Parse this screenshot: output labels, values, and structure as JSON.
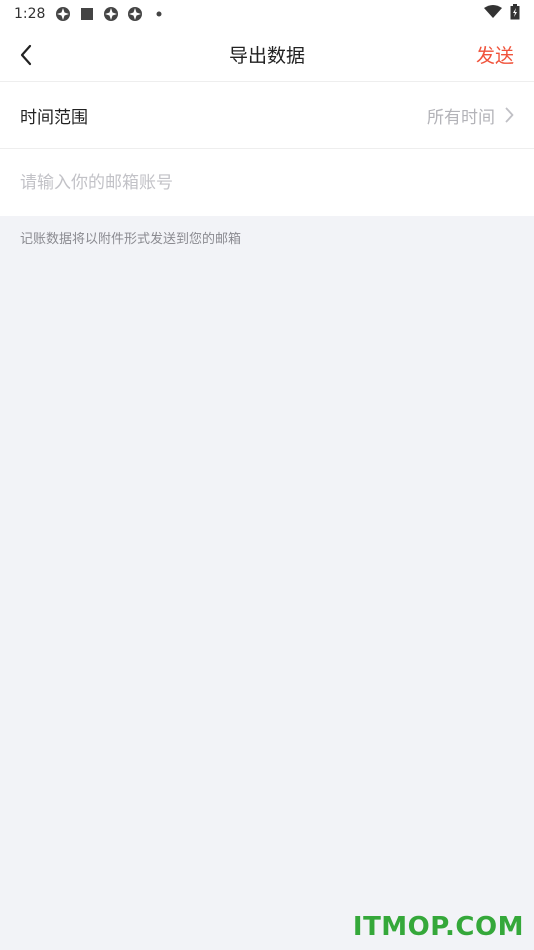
{
  "status_bar": {
    "time": "1:28",
    "left_icons": [
      "app-icon",
      "square-icon",
      "app-icon",
      "app-icon",
      "dot-icon"
    ],
    "right_icons": [
      "wifi-icon",
      "battery-icon"
    ]
  },
  "nav": {
    "title": "导出数据",
    "send_label": "发送",
    "accent_color": "#f0533b"
  },
  "time_range": {
    "label": "时间范围",
    "value": "所有时间"
  },
  "email": {
    "placeholder": "请输入你的邮箱账号",
    "value": ""
  },
  "hint": "记账数据将以附件形式发送到您的邮箱",
  "watermark": "ITMOP.COM"
}
